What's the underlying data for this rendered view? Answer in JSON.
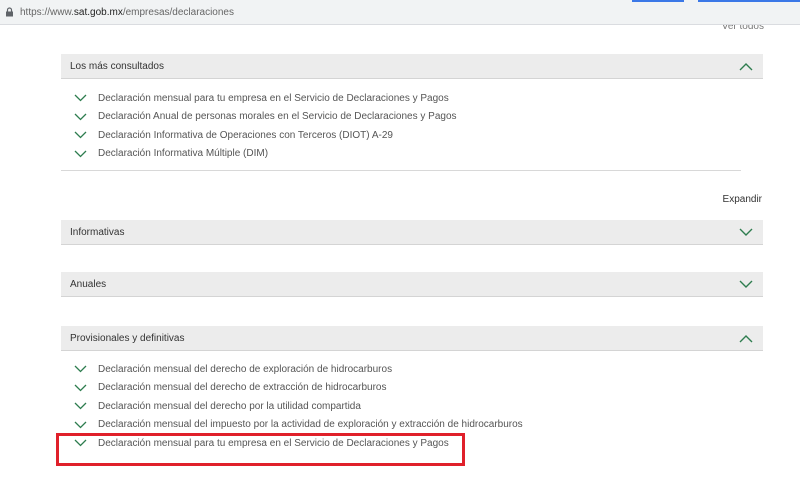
{
  "browser": {
    "url_prefix": "https://www.",
    "url_domain": "sat.gob.mx",
    "url_path": "/empresas/declaraciones"
  },
  "top_link": "Ver todos",
  "mas_consultados": {
    "title": "Los más consultados",
    "items": [
      "Declaración mensual para tu empresa en el Servicio de Declaraciones y Pagos",
      "Declaración Anual de personas morales en el Servicio de Declaraciones y Pagos",
      "Declaración Informativa de Operaciones con Terceros (DIOT) A-29",
      "Declaración Informativa Múltiple (DIM)"
    ]
  },
  "expandir": "Expandir",
  "informativas": {
    "title": "Informativas"
  },
  "anuales": {
    "title": "Anuales"
  },
  "provisionales": {
    "title": "Provisionales y definitivas",
    "items": [
      "Declaración mensual del derecho de exploración de hidrocarburos",
      "Declaración mensual del derecho de extracción de hidrocarburos",
      "Declaración mensual del derecho por la utilidad compartida",
      "Declaración mensual del impuesto por la actividad de exploración y extracción de hidrocarburos",
      "Declaración mensual para tu empresa en el Servicio de Declaraciones y Pagos"
    ]
  },
  "colors": {
    "accent": "#2e7d4f",
    "highlight": "#e0202a",
    "header_bg": "#ececec"
  }
}
